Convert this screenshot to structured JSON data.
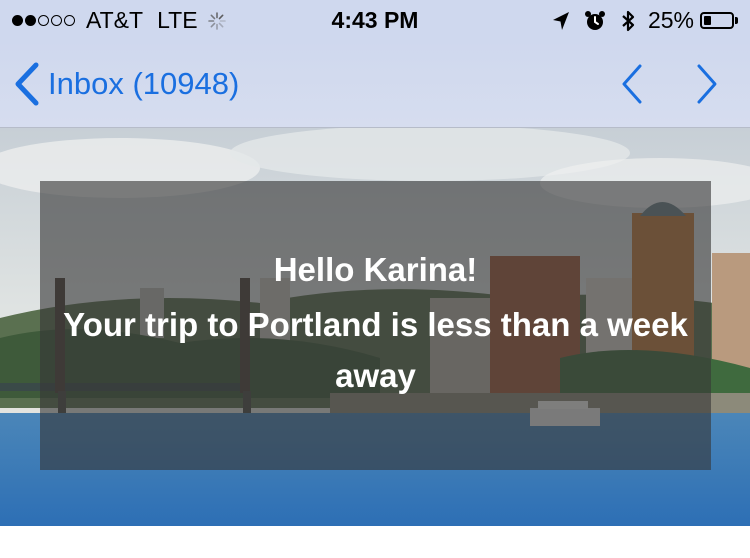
{
  "status_bar": {
    "signal_bars_filled": 2,
    "signal_bars_total": 5,
    "carrier": "AT&T",
    "network": "LTE",
    "time": "4:43 PM",
    "battery_percent": "25%",
    "battery_level": 0.25,
    "icons": [
      "location-arrow-icon",
      "alarm-clock-icon",
      "bluetooth-icon",
      "battery-icon"
    ]
  },
  "nav": {
    "back_label": "Inbox (10948)",
    "accent_color": "#1a6fe0"
  },
  "email": {
    "greeting": "Hello Karina!",
    "message": "Your trip to Portland is less than a week away"
  }
}
